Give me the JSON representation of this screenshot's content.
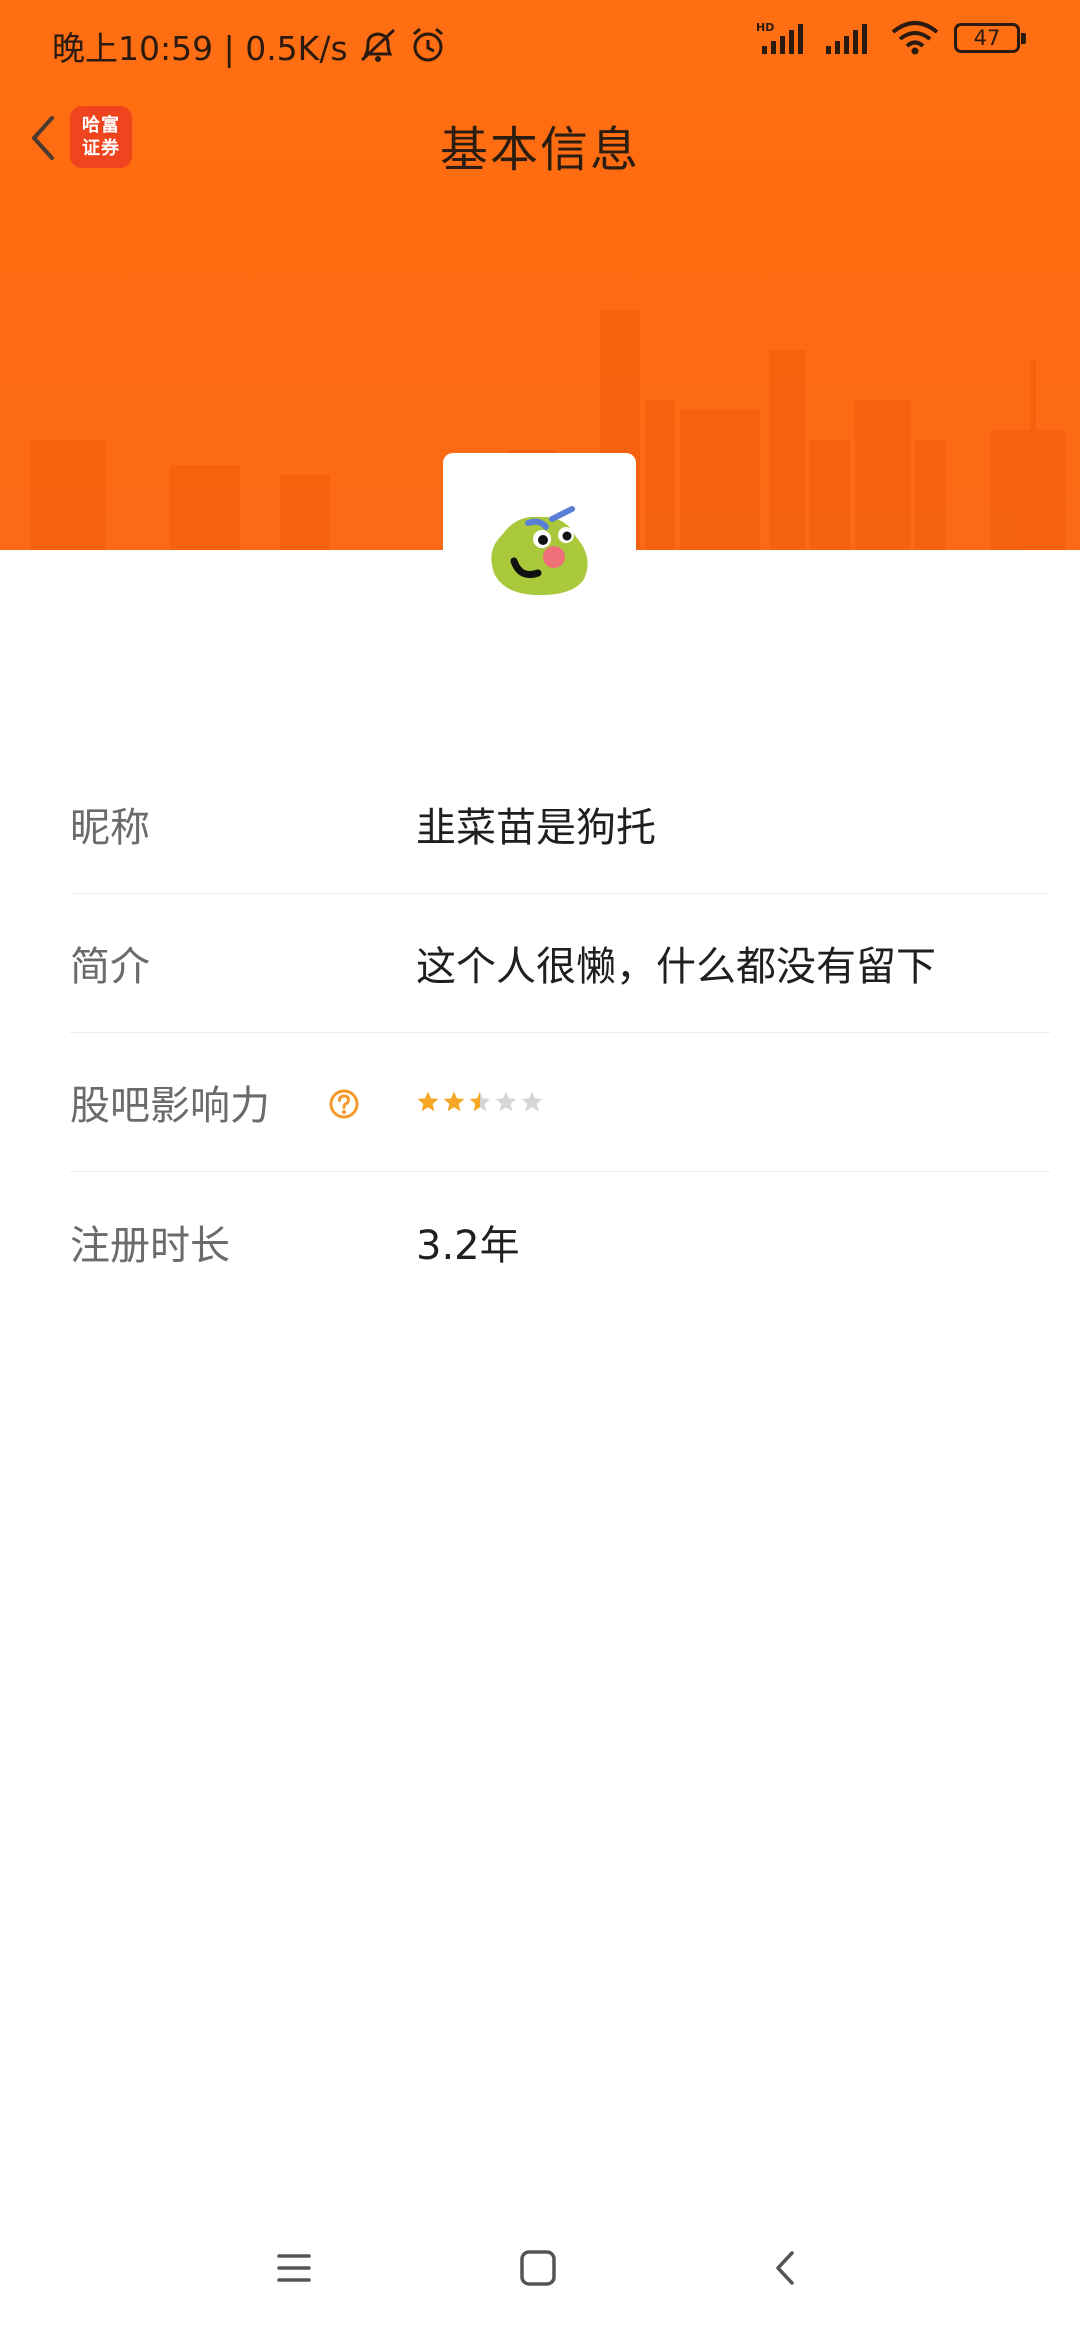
{
  "status_bar": {
    "time": "晚上10:59 | 0.5K/s",
    "battery": "47",
    "icons": [
      "bell-muted-icon",
      "alarm-icon",
      "hd-signal-icon",
      "signal-icon",
      "wifi-icon",
      "battery-icon"
    ]
  },
  "nav": {
    "title": "基本信息",
    "logo_line1": "哈富",
    "logo_line2": "证券",
    "back_icon": "chevron-left-icon"
  },
  "profile": {
    "avatar_icon": "green-blob-avatar-icon",
    "fields": [
      {
        "label": "昵称",
        "value": "韭菜苗是狗托"
      },
      {
        "label": "简介",
        "value": "这个人很懒，什么都没有留下"
      },
      {
        "label": "股吧影响力",
        "rating": 2.5,
        "max": 5,
        "help_icon": "question-circle-icon"
      },
      {
        "label": "注册时长",
        "value": "3.2年"
      }
    ]
  },
  "colors": {
    "header": "#ff6f12",
    "star_active": "#f5a623",
    "star_inactive": "#d6d6d6",
    "help_icon": "#f39a2a"
  },
  "system_nav": [
    "menu-icon",
    "home-icon",
    "back-icon"
  ]
}
